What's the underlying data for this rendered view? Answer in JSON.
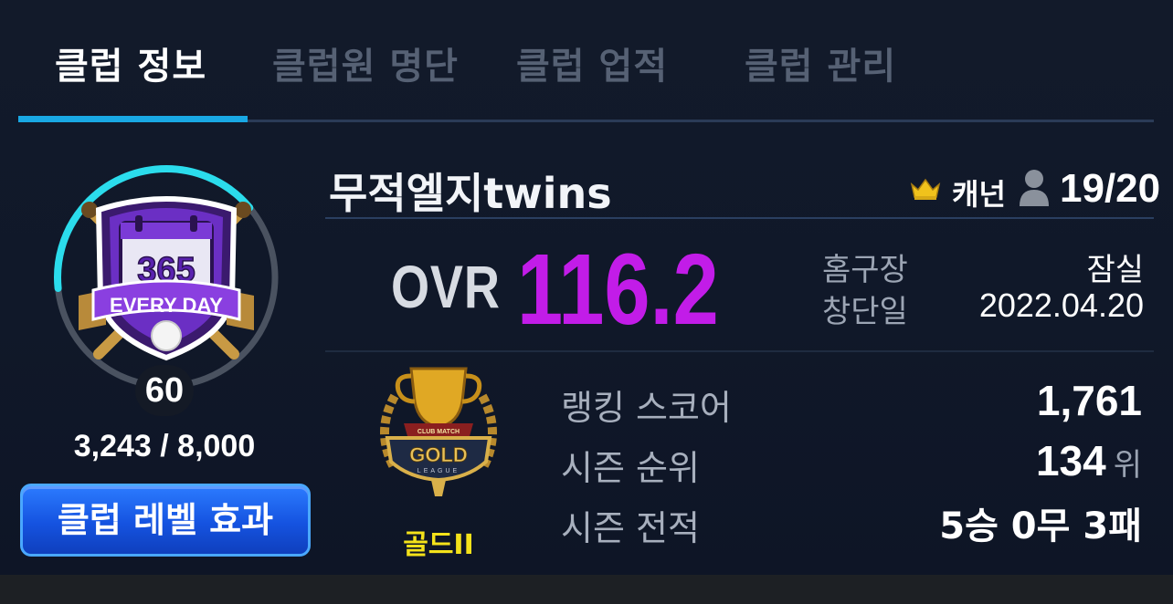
{
  "tabs": [
    {
      "label": "클럽 정보",
      "active": true
    },
    {
      "label": "클럽원 명단",
      "active": false
    },
    {
      "label": "클럽 업적",
      "active": false
    },
    {
      "label": "클럽 관리",
      "active": false
    }
  ],
  "club": {
    "name": "무적엘지twins",
    "owner": "캐넌",
    "members": "19/20",
    "emblem_text": "365",
    "emblem_banner": "EVERY DAY"
  },
  "level": {
    "value": "60",
    "exp_text": "3,243 / 8,000",
    "exp_fraction": 0.405,
    "button_label": "클럽 레벨 효과"
  },
  "ovr": {
    "label": "OVR",
    "value": "116.2"
  },
  "info": {
    "home_label": "홈구장",
    "home_value": "잠실",
    "founded_label": "창단일",
    "founded_value": "2022.04.20"
  },
  "league": {
    "name": "골드II",
    "emblem_top_text": "CLUB MATCH",
    "emblem_main_text": "GOLD",
    "emblem_sub_text": "LEAGUE"
  },
  "stats": {
    "ranking_label": "랭킹 스코어",
    "ranking_value": "1,761",
    "season_rank_label": "시즌 순위",
    "season_rank_value": "134",
    "season_rank_unit": "위",
    "season_record_label": "시즌 전적",
    "season_record_value": "5승 0무 3패"
  },
  "colors": {
    "accent": "#19a8e4",
    "ovr": "#c21ce8",
    "league": "#f4e21a",
    "button": "#1553e0"
  }
}
